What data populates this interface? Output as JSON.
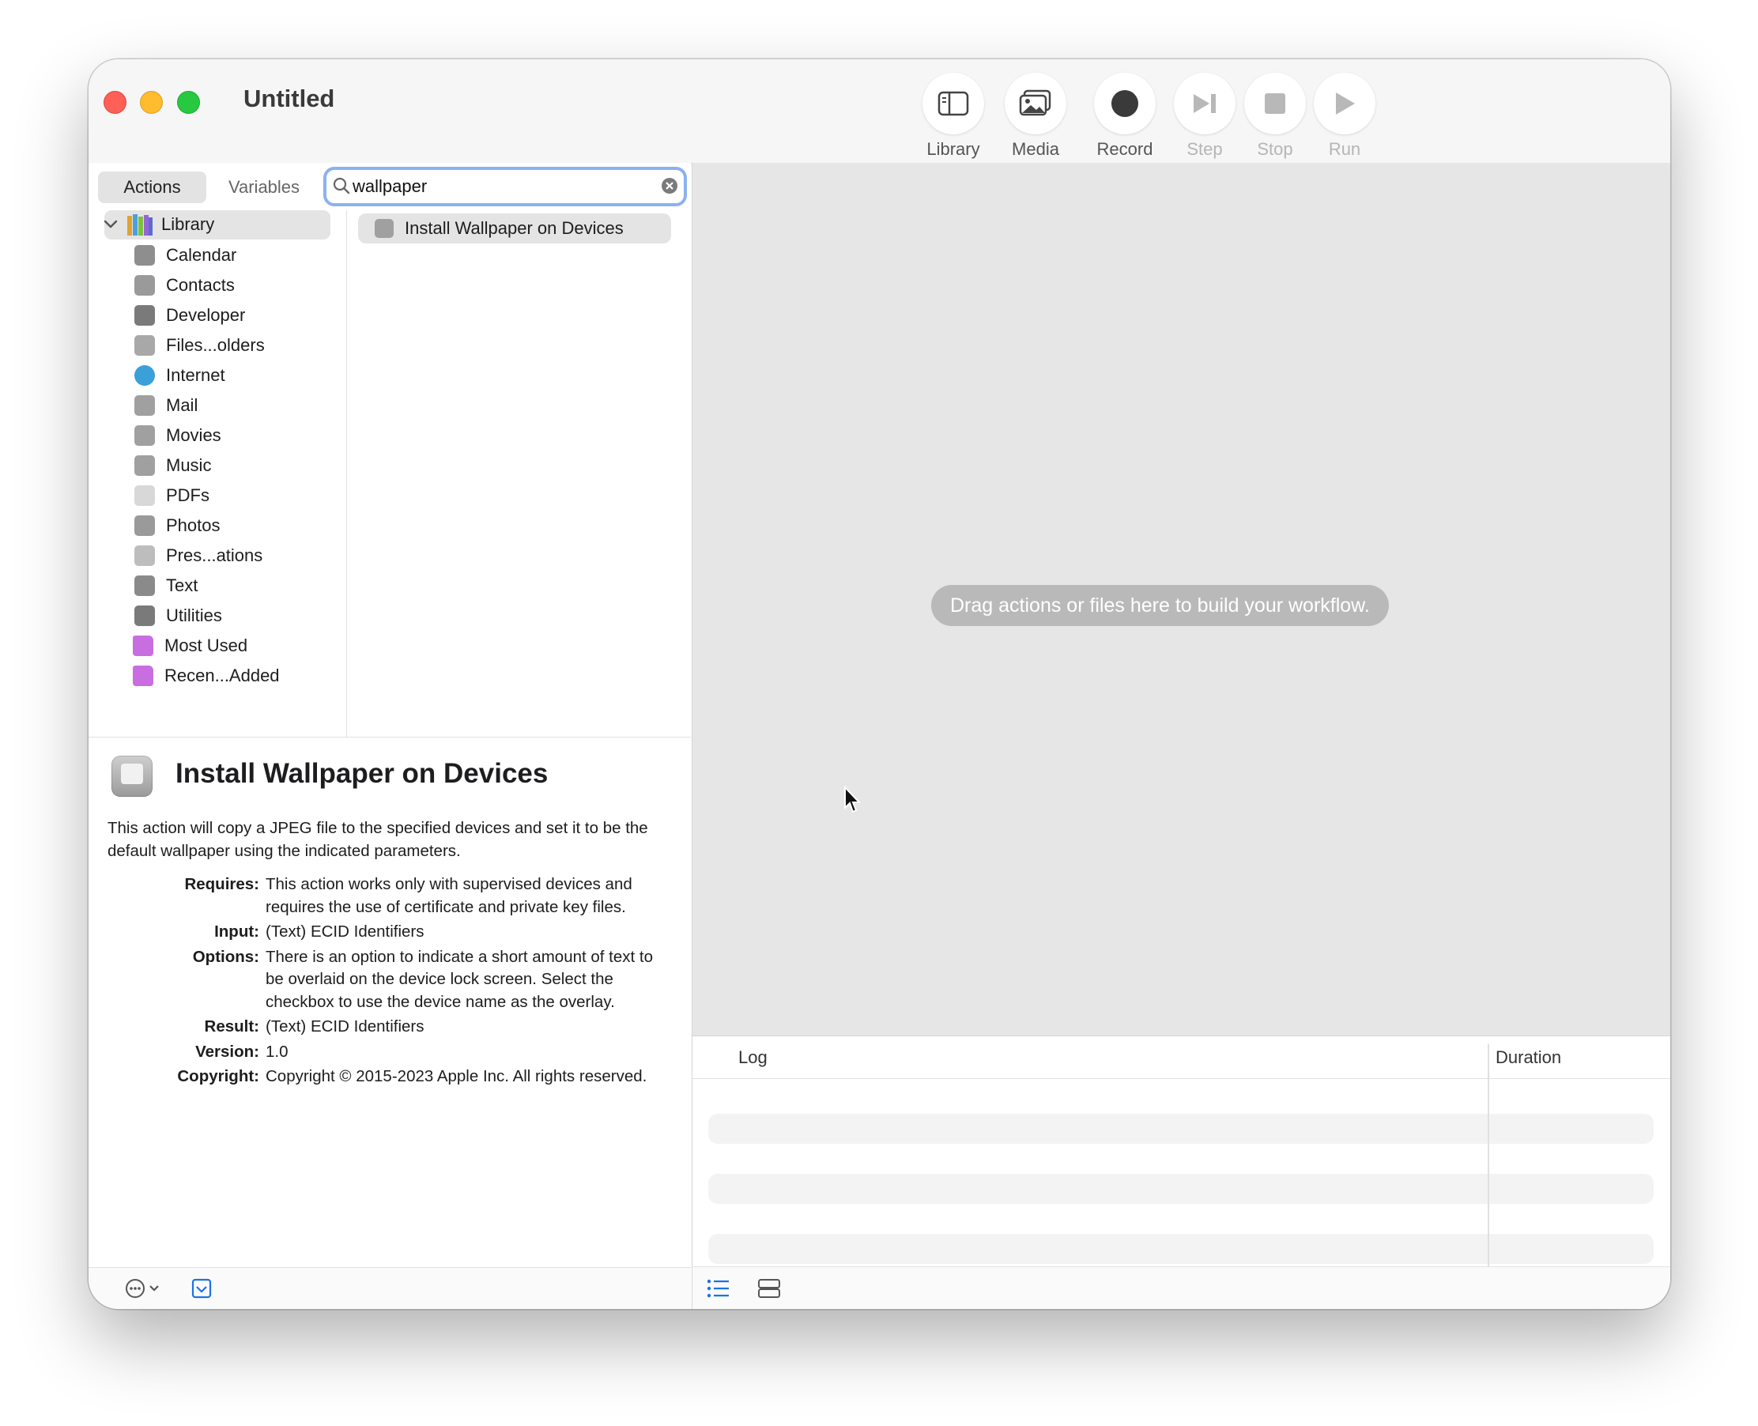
{
  "window": {
    "title": "Untitled"
  },
  "toolbar": {
    "library_label": "Library",
    "media_label": "Media",
    "record_label": "Record",
    "step_label": "Step",
    "stop_label": "Stop",
    "run_label": "Run"
  },
  "tabs": {
    "actions": "Actions",
    "variables": "Variables"
  },
  "search": {
    "value": "wallpaper"
  },
  "library": {
    "root": "Library",
    "items": [
      {
        "label": "Calendar",
        "icon": "calendar-icon",
        "color": "#8e8e8e"
      },
      {
        "label": "Contacts",
        "icon": "contacts-icon",
        "color": "#9a9a9a"
      },
      {
        "label": "Developer",
        "icon": "developer-icon",
        "color": "#7a7a7a"
      },
      {
        "label": "Files...olders",
        "icon": "files-folders-icon",
        "color": "#a8a8a8"
      },
      {
        "label": "Internet",
        "icon": "internet-icon",
        "color": "#3aa0d8"
      },
      {
        "label": "Mail",
        "icon": "mail-icon",
        "color": "#a0a0a0"
      },
      {
        "label": "Movies",
        "icon": "movies-icon",
        "color": "#a0a0a0"
      },
      {
        "label": "Music",
        "icon": "music-icon",
        "color": "#a0a0a0"
      },
      {
        "label": "PDFs",
        "icon": "pdfs-icon",
        "color": "#d8d8d8"
      },
      {
        "label": "Photos",
        "icon": "photos-icon",
        "color": "#9a9a9a"
      },
      {
        "label": "Pres...ations",
        "icon": "presentations-icon",
        "color": "#bdbdbd"
      },
      {
        "label": "Text",
        "icon": "text-icon",
        "color": "#8a8a8a"
      },
      {
        "label": "Utilities",
        "icon": "utilities-icon",
        "color": "#7a7a7a"
      }
    ],
    "smart_folders": [
      {
        "label": "Most Used",
        "icon": "smart-folder-icon",
        "color": "#c86ee0"
      },
      {
        "label": "Recen...Added",
        "icon": "smart-folder-icon",
        "color": "#c86ee0"
      }
    ]
  },
  "results": [
    {
      "label": "Install Wallpaper on Devices"
    }
  ],
  "description": {
    "title": "Install Wallpaper on Devices",
    "summary": "This action will copy a JPEG file to the specified devices and set it to be the default wallpaper using the indicated parameters.",
    "fields": [
      {
        "label": "Requires:",
        "value": "This action works only with supervised devices and requires the use of certificate and private key files."
      },
      {
        "label": "Input:",
        "value": "(Text) ECID Identifiers"
      },
      {
        "label": "Options:",
        "value": "There is an option to indicate a short amount of text to be overlaid on the device lock screen. Select the checkbox to use the device name as the overlay."
      },
      {
        "label": "Result:",
        "value": "(Text) ECID Identifiers"
      },
      {
        "label": "Version:",
        "value": "1.0"
      },
      {
        "label": "Copyright:",
        "value": "Copyright © 2015-2023 Apple Inc. All rights reserved."
      }
    ]
  },
  "workflow": {
    "hint": "Drag actions or files here to build your workflow."
  },
  "log": {
    "col_log": "Log",
    "col_duration": "Duration"
  },
  "colors": {
    "accent": "#1a73e8",
    "search_focus": "#8bb2ef",
    "close": "#fe5f57",
    "minimize": "#febc2e",
    "maximize": "#28c840"
  }
}
